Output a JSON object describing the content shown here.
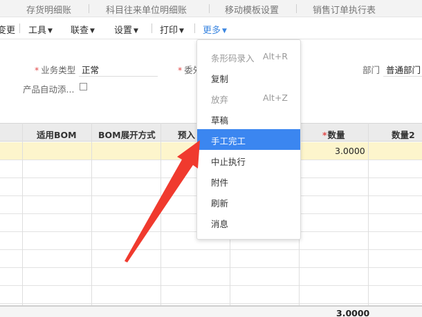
{
  "tabs": [
    "存货明细账",
    "科目往来单位明细账",
    "移动模板设置",
    "销售订单执行表"
  ],
  "toolbar": {
    "partial_item": "变更",
    "tools": "工具",
    "lookup": "联查",
    "settings": "设置",
    "print": "打印",
    "more": "更多"
  },
  "form": {
    "business_type_label": "业务类型",
    "business_type_value": "正常",
    "partial_label": "委外",
    "dept_label": "部门",
    "dept_value": "普通部门",
    "auto_add_label": "产品自动添..."
  },
  "grid": {
    "headers": [
      "适用BOM",
      "BOM展开方式",
      "预入",
      "数量",
      "数量2"
    ],
    "rows": [
      {
        "qty": "3.0000"
      }
    ],
    "total_qty": "3.0000"
  },
  "menu": {
    "items": [
      {
        "label": "条形码录入",
        "shortcut": "Alt+R",
        "state": "disabled"
      },
      {
        "label": "复制",
        "shortcut": "",
        "state": "enabled"
      },
      {
        "label": "放弃",
        "shortcut": "Alt+Z",
        "state": "disabled"
      },
      {
        "label": "草稿",
        "shortcut": "",
        "state": "enabled"
      },
      {
        "label": "手工完工",
        "shortcut": "",
        "state": "active"
      },
      {
        "label": "中止执行",
        "shortcut": "",
        "state": "enabled"
      },
      {
        "label": "附件",
        "shortcut": "",
        "state": "enabled"
      },
      {
        "label": "刷新",
        "shortcut": "",
        "state": "enabled"
      },
      {
        "label": "消息",
        "shortcut": "",
        "state": "enabled"
      }
    ]
  },
  "colors": {
    "accent": "#3b86f0",
    "selected_row": "#fdf5cc",
    "arrow": "#f03a2e",
    "required": "#e24b4b"
  }
}
